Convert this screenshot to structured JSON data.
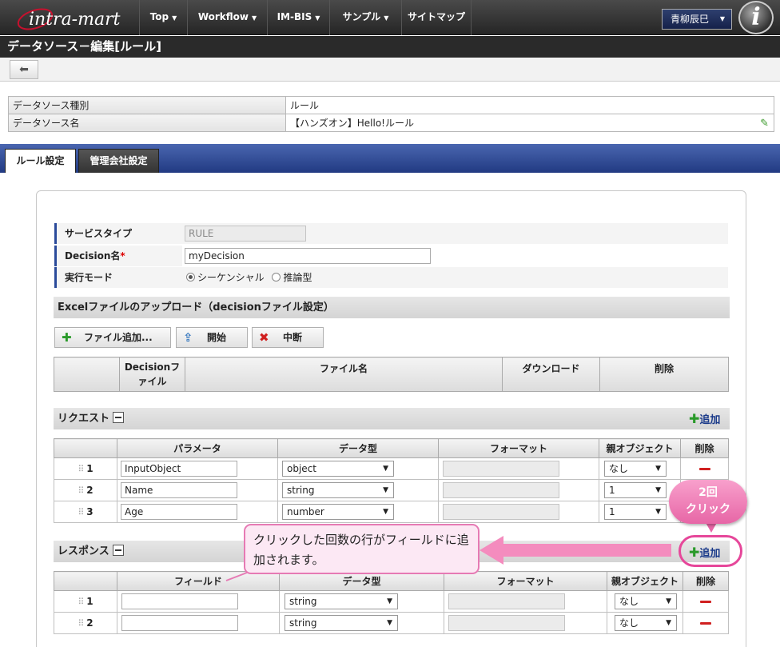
{
  "header": {
    "logo_text": "intra-mart",
    "nav": [
      {
        "label": "Top",
        "has_dropdown": true
      },
      {
        "label": "Workflow",
        "has_dropdown": true
      },
      {
        "label": "IM-BIS",
        "has_dropdown": true
      },
      {
        "label": "サンプル",
        "has_dropdown": true
      },
      {
        "label": "サイトマップ",
        "has_dropdown": false
      }
    ],
    "user_name": "青柳辰巳",
    "badge_letter": "i"
  },
  "page_title": "データソース－編集[ルール]",
  "toolbar": {
    "back_icon": "left-arrow-icon",
    "back_glyph": "🡐"
  },
  "info": {
    "rows": [
      {
        "label": "データソース種別",
        "value": "ルール"
      },
      {
        "label": "データソース名",
        "value": "【ハンズオン】Hello!ルール"
      }
    ],
    "edit_icon": "pencil-icon"
  },
  "tabs": [
    {
      "label": "ルール設定",
      "active": true
    },
    {
      "label": "管理会社設定",
      "active": false
    }
  ],
  "form": {
    "service_type": {
      "label": "サービスタイプ",
      "value": "RULE"
    },
    "decision_name": {
      "label": "Decision名",
      "required_mark": "*",
      "value": "myDecision"
    },
    "exec_mode": {
      "label": "実行モード",
      "options": [
        "シーケンシャル",
        "推論型"
      ],
      "selected": "シーケンシャル"
    }
  },
  "upload": {
    "title": "Excelファイルのアップロード（decisionファイル設定）",
    "buttons": {
      "add": "ファイル追加...",
      "start": "開始",
      "stop": "中断"
    },
    "columns": [
      "",
      "Decisionファイル",
      "ファイル名",
      "ダウンロード",
      "削除"
    ]
  },
  "request": {
    "title": "リクエスト",
    "add_label": "追加",
    "columns": [
      "",
      "パラメータ",
      "データ型",
      "フォーマット",
      "親オブジェクト",
      "削除"
    ],
    "rows": [
      {
        "no": "1",
        "param": "InputObject",
        "type": "object",
        "parent": "なし"
      },
      {
        "no": "2",
        "param": "Name",
        "type": "string",
        "parent": "1"
      },
      {
        "no": "3",
        "param": "Age",
        "type": "number",
        "parent": "1"
      }
    ]
  },
  "response": {
    "title": "レスポンス",
    "add_label": "追加",
    "columns": [
      "",
      "フィールド",
      "データ型",
      "フォーマット",
      "親オブジェクト",
      "削除"
    ],
    "rows": [
      {
        "no": "1",
        "field": "",
        "type": "string",
        "parent": "なし"
      },
      {
        "no": "2",
        "field": "",
        "type": "string",
        "parent": "なし"
      }
    ]
  },
  "annotations": {
    "callout_text": "クリックした回数の行がフィールドに追加されます。",
    "click_bubble_line1": "2回",
    "click_bubble_line2": "クリック",
    "accent_color": "#e6479a"
  }
}
